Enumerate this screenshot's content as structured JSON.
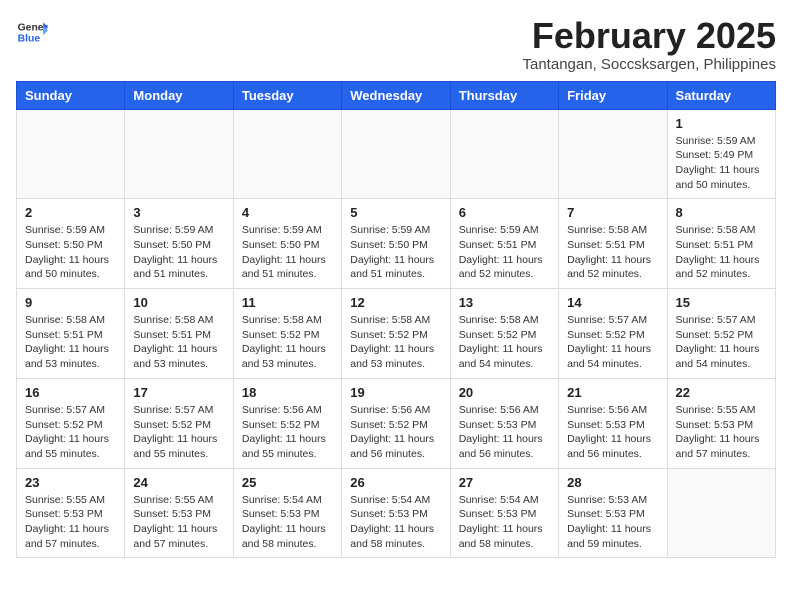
{
  "header": {
    "logo_general": "General",
    "logo_blue": "Blue",
    "title": "February 2025",
    "subtitle": "Tantangan, Soccsksargen, Philippines"
  },
  "weekdays": [
    "Sunday",
    "Monday",
    "Tuesday",
    "Wednesday",
    "Thursday",
    "Friday",
    "Saturday"
  ],
  "weeks": [
    [
      {
        "day": "",
        "info": ""
      },
      {
        "day": "",
        "info": ""
      },
      {
        "day": "",
        "info": ""
      },
      {
        "day": "",
        "info": ""
      },
      {
        "day": "",
        "info": ""
      },
      {
        "day": "",
        "info": ""
      },
      {
        "day": "1",
        "info": "Sunrise: 5:59 AM\nSunset: 5:49 PM\nDaylight: 11 hours and 50 minutes."
      }
    ],
    [
      {
        "day": "2",
        "info": "Sunrise: 5:59 AM\nSunset: 5:50 PM\nDaylight: 11 hours and 50 minutes."
      },
      {
        "day": "3",
        "info": "Sunrise: 5:59 AM\nSunset: 5:50 PM\nDaylight: 11 hours and 51 minutes."
      },
      {
        "day": "4",
        "info": "Sunrise: 5:59 AM\nSunset: 5:50 PM\nDaylight: 11 hours and 51 minutes."
      },
      {
        "day": "5",
        "info": "Sunrise: 5:59 AM\nSunset: 5:50 PM\nDaylight: 11 hours and 51 minutes."
      },
      {
        "day": "6",
        "info": "Sunrise: 5:59 AM\nSunset: 5:51 PM\nDaylight: 11 hours and 52 minutes."
      },
      {
        "day": "7",
        "info": "Sunrise: 5:58 AM\nSunset: 5:51 PM\nDaylight: 11 hours and 52 minutes."
      },
      {
        "day": "8",
        "info": "Sunrise: 5:58 AM\nSunset: 5:51 PM\nDaylight: 11 hours and 52 minutes."
      }
    ],
    [
      {
        "day": "9",
        "info": "Sunrise: 5:58 AM\nSunset: 5:51 PM\nDaylight: 11 hours and 53 minutes."
      },
      {
        "day": "10",
        "info": "Sunrise: 5:58 AM\nSunset: 5:51 PM\nDaylight: 11 hours and 53 minutes."
      },
      {
        "day": "11",
        "info": "Sunrise: 5:58 AM\nSunset: 5:52 PM\nDaylight: 11 hours and 53 minutes."
      },
      {
        "day": "12",
        "info": "Sunrise: 5:58 AM\nSunset: 5:52 PM\nDaylight: 11 hours and 53 minutes."
      },
      {
        "day": "13",
        "info": "Sunrise: 5:58 AM\nSunset: 5:52 PM\nDaylight: 11 hours and 54 minutes."
      },
      {
        "day": "14",
        "info": "Sunrise: 5:57 AM\nSunset: 5:52 PM\nDaylight: 11 hours and 54 minutes."
      },
      {
        "day": "15",
        "info": "Sunrise: 5:57 AM\nSunset: 5:52 PM\nDaylight: 11 hours and 54 minutes."
      }
    ],
    [
      {
        "day": "16",
        "info": "Sunrise: 5:57 AM\nSunset: 5:52 PM\nDaylight: 11 hours and 55 minutes."
      },
      {
        "day": "17",
        "info": "Sunrise: 5:57 AM\nSunset: 5:52 PM\nDaylight: 11 hours and 55 minutes."
      },
      {
        "day": "18",
        "info": "Sunrise: 5:56 AM\nSunset: 5:52 PM\nDaylight: 11 hours and 55 minutes."
      },
      {
        "day": "19",
        "info": "Sunrise: 5:56 AM\nSunset: 5:52 PM\nDaylight: 11 hours and 56 minutes."
      },
      {
        "day": "20",
        "info": "Sunrise: 5:56 AM\nSunset: 5:53 PM\nDaylight: 11 hours and 56 minutes."
      },
      {
        "day": "21",
        "info": "Sunrise: 5:56 AM\nSunset: 5:53 PM\nDaylight: 11 hours and 56 minutes."
      },
      {
        "day": "22",
        "info": "Sunrise: 5:55 AM\nSunset: 5:53 PM\nDaylight: 11 hours and 57 minutes."
      }
    ],
    [
      {
        "day": "23",
        "info": "Sunrise: 5:55 AM\nSunset: 5:53 PM\nDaylight: 11 hours and 57 minutes."
      },
      {
        "day": "24",
        "info": "Sunrise: 5:55 AM\nSunset: 5:53 PM\nDaylight: 11 hours and 57 minutes."
      },
      {
        "day": "25",
        "info": "Sunrise: 5:54 AM\nSunset: 5:53 PM\nDaylight: 11 hours and 58 minutes."
      },
      {
        "day": "26",
        "info": "Sunrise: 5:54 AM\nSunset: 5:53 PM\nDaylight: 11 hours and 58 minutes."
      },
      {
        "day": "27",
        "info": "Sunrise: 5:54 AM\nSunset: 5:53 PM\nDaylight: 11 hours and 58 minutes."
      },
      {
        "day": "28",
        "info": "Sunrise: 5:53 AM\nSunset: 5:53 PM\nDaylight: 11 hours and 59 minutes."
      },
      {
        "day": "",
        "info": ""
      }
    ]
  ]
}
